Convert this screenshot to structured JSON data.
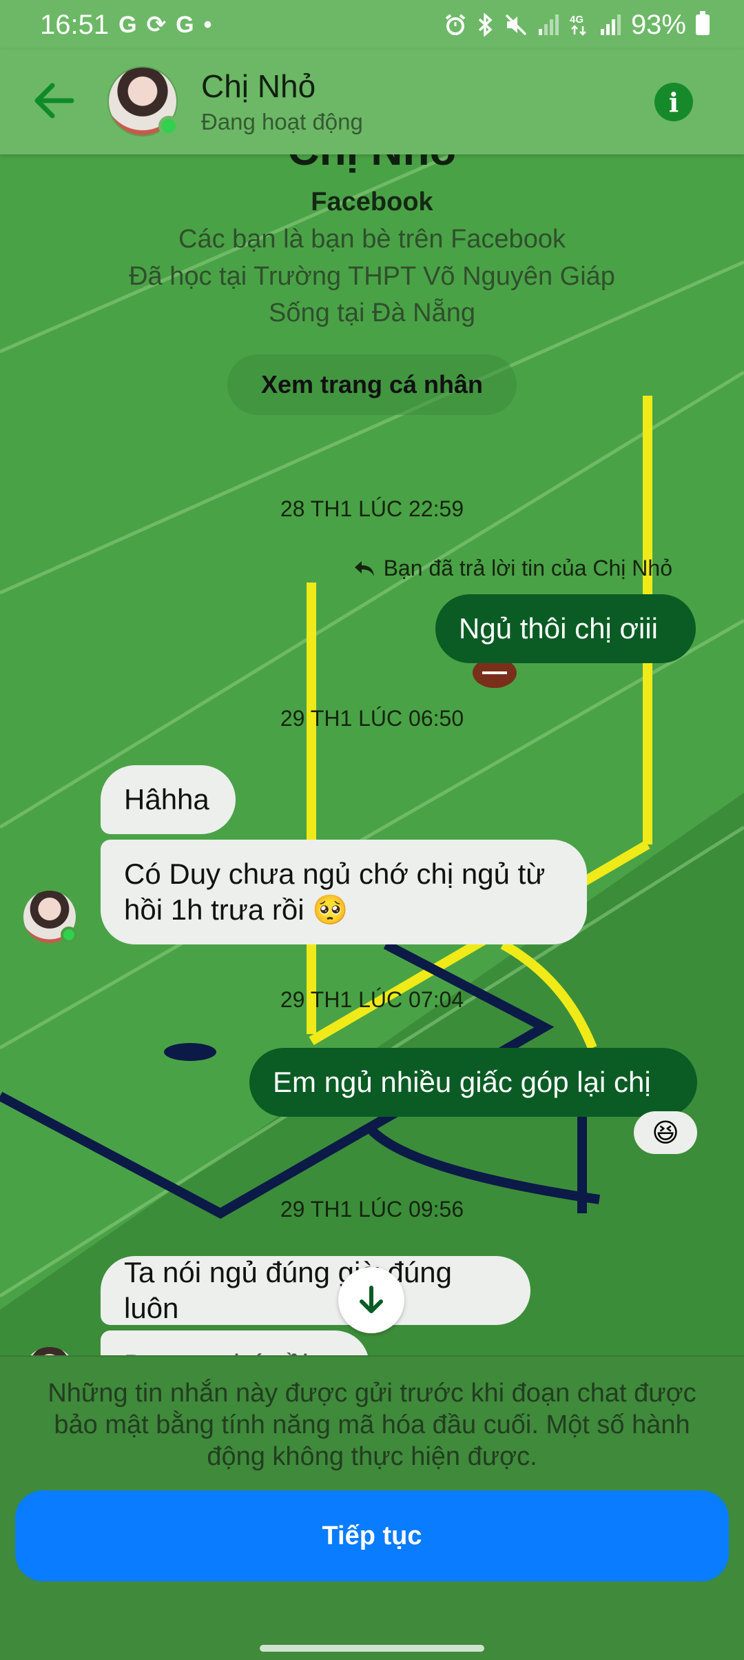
{
  "status_bar": {
    "time": "16:51",
    "left_icons": [
      "G",
      "⟳",
      "G",
      "•"
    ],
    "right_icons": [
      "alarm-icon",
      "bluetooth-icon",
      "mute-icon",
      "signal-icon",
      "4g-icon",
      "signal-icon"
    ],
    "battery": "93%"
  },
  "header": {
    "contact_name": "Chị Nhỏ",
    "status": "Đang hoạt động"
  },
  "intro": {
    "name": "Chị Nhỏ",
    "platform": "Facebook",
    "line1": "Các bạn là bạn bè trên Facebook",
    "line2": "Đã học tại Trường THPT Võ Nguyên Giáp",
    "line3": "Sống tại Đà Nẵng",
    "view_profile": "Xem trang cá nhân"
  },
  "messages": {
    "ts1": "28 TH1 LÚC 22:59",
    "reply_note": "Bạn đã trả lời tin của Chị Nhỏ",
    "m1": "Ngủ thôi chị ơiii",
    "ts2": "29 TH1 LÚC 06:50",
    "m2": "Hâhha",
    "m3a": "Có Duy chưa ngủ chớ chị ngủ từ",
    "m3b": "hồi 1h trưa rồi 🥺",
    "ts3": "29 TH1 LÚC 07:04",
    "m4": "Em ngủ nhiều giấc góp lại chị",
    "m4_reaction": "😆",
    "ts4": "29 TH1 LÚC 09:56",
    "m5": "Ta nói ngủ đúng giờ đúng luôn",
    "m6_partial": "Dạ em nhớ rồi"
  },
  "notice": {
    "text": "Những tin nhắn này được gửi trước khi đoạn chat được bảo mật bằng tính năng mã hóa đầu cuối. Một số hành động không thực hiện được.",
    "button": "Tiếp tục"
  },
  "colors": {
    "header_bg": "#6cb866",
    "outgoing_bubble": "#0a5c24",
    "incoming_bubble": "#ecefec",
    "primary_button": "#0a7cff"
  }
}
